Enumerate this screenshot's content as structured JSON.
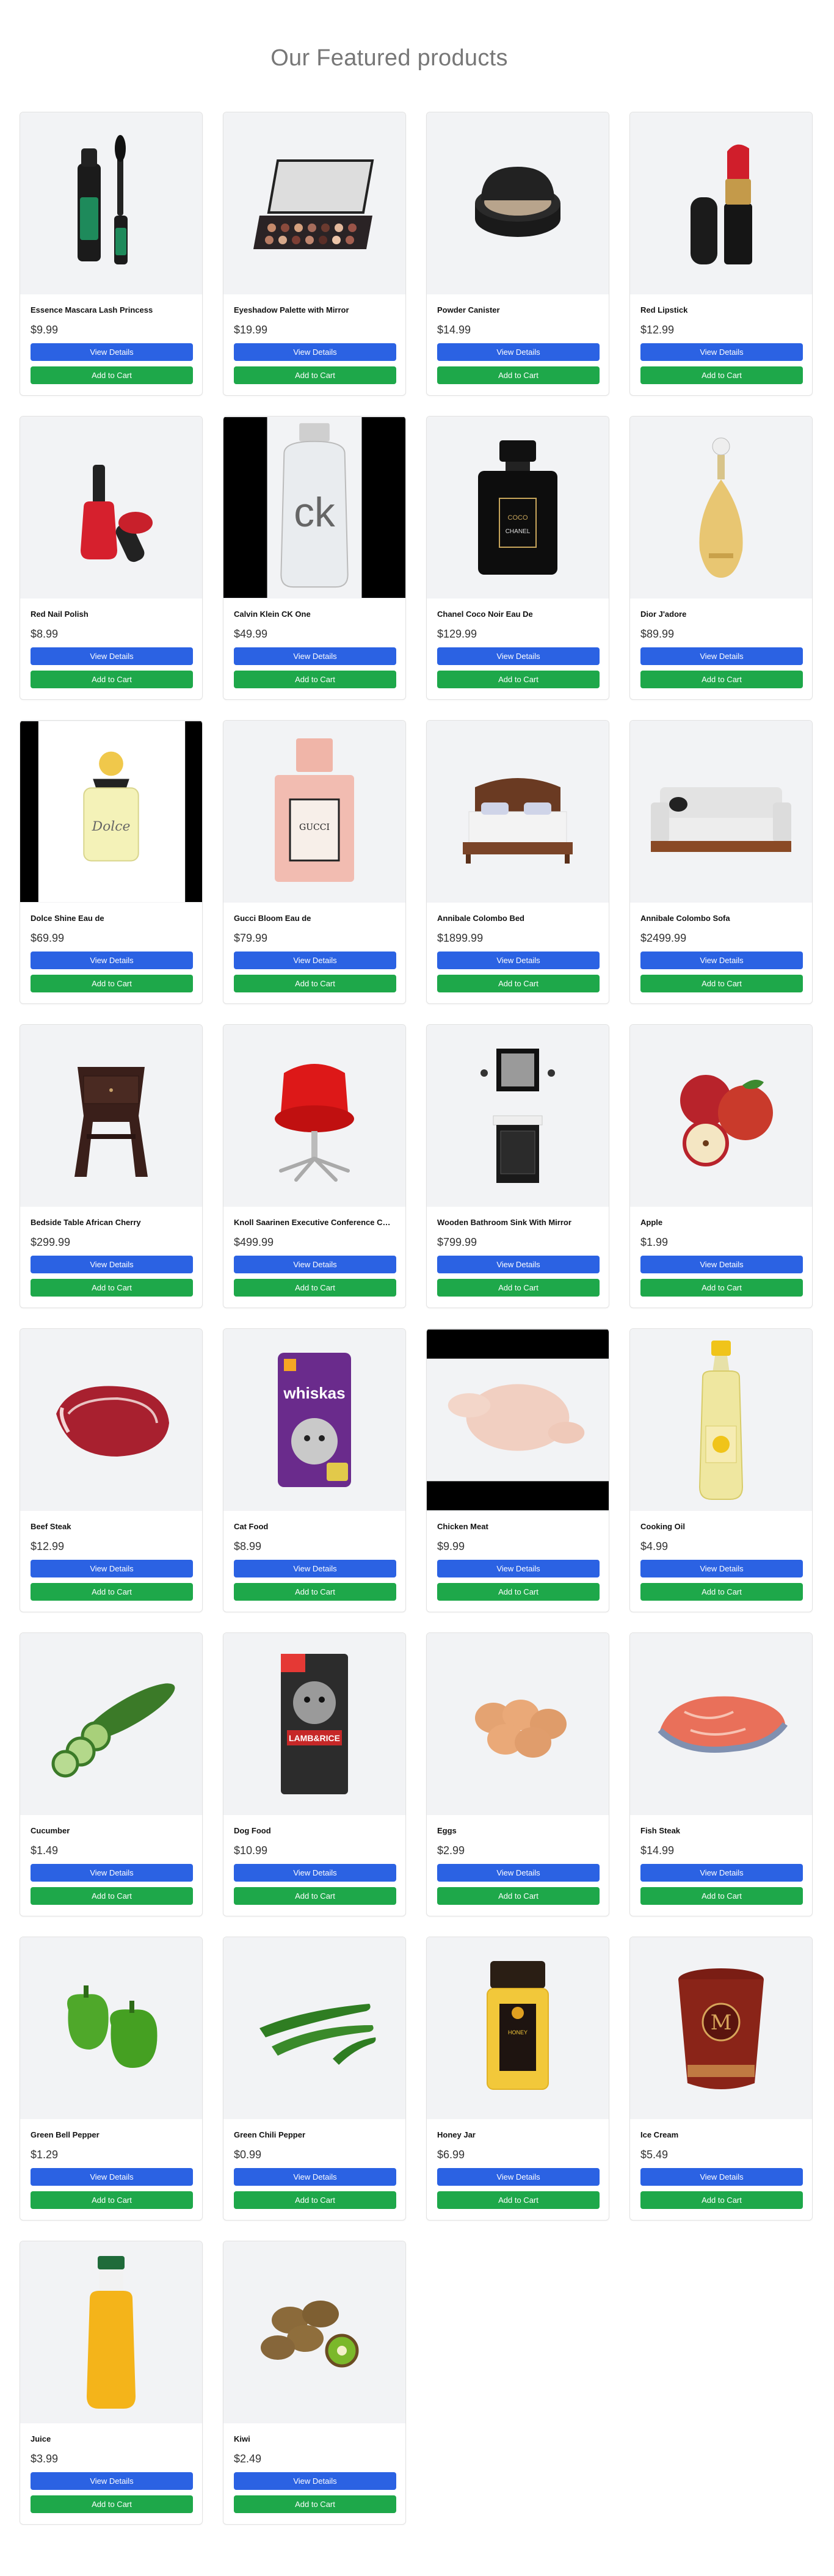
{
  "section": {
    "title": "Our Featured products"
  },
  "buttons": {
    "view_label": "View Details",
    "cart_label": "Add to Cart"
  },
  "colors": {
    "view_button": "#2b62e3",
    "cart_button": "#1ea84a",
    "image_bg": "#f2f3f5"
  },
  "products": [
    {
      "name": "Essence Mascara Lash Princess",
      "price": "$9.99",
      "icon": "mascara-icon"
    },
    {
      "name": "Eyeshadow Palette with Mirror",
      "price": "$19.99",
      "icon": "palette-icon"
    },
    {
      "name": "Powder Canister",
      "price": "$14.99",
      "icon": "powder-icon"
    },
    {
      "name": "Red Lipstick",
      "price": "$12.99",
      "icon": "lipstick-icon"
    },
    {
      "name": "Red Nail Polish",
      "price": "$8.99",
      "icon": "nail-polish-icon"
    },
    {
      "name": "Calvin Klein CK One",
      "price": "$49.99",
      "icon": "perfume-ck-icon"
    },
    {
      "name": "Chanel Coco Noir Eau De",
      "price": "$129.99",
      "icon": "perfume-chanel-icon"
    },
    {
      "name": "Dior J'adore",
      "price": "$89.99",
      "icon": "perfume-dior-icon"
    },
    {
      "name": "Dolce Shine Eau de",
      "price": "$69.99",
      "icon": "perfume-dolce-icon"
    },
    {
      "name": "Gucci Bloom Eau de",
      "price": "$79.99",
      "icon": "perfume-gucci-icon"
    },
    {
      "name": "Annibale Colombo Bed",
      "price": "$1899.99",
      "icon": "bed-icon"
    },
    {
      "name": "Annibale Colombo Sofa",
      "price": "$2499.99",
      "icon": "sofa-icon"
    },
    {
      "name": "Bedside Table African Cherry",
      "price": "$299.99",
      "icon": "bedside-table-icon"
    },
    {
      "name": "Knoll Saarinen Executive Conference Chair",
      "price": "$499.99",
      "icon": "chair-icon"
    },
    {
      "name": "Wooden Bathroom Sink With Mirror",
      "price": "$799.99",
      "icon": "sink-icon"
    },
    {
      "name": "Apple",
      "price": "$1.99",
      "icon": "apple-icon"
    },
    {
      "name": "Beef Steak",
      "price": "$12.99",
      "icon": "steak-icon"
    },
    {
      "name": "Cat Food",
      "price": "$8.99",
      "icon": "cat-food-icon"
    },
    {
      "name": "Chicken Meat",
      "price": "$9.99",
      "icon": "chicken-icon"
    },
    {
      "name": "Cooking Oil",
      "price": "$4.99",
      "icon": "oil-icon"
    },
    {
      "name": "Cucumber",
      "price": "$1.49",
      "icon": "cucumber-icon"
    },
    {
      "name": "Dog Food",
      "price": "$10.99",
      "icon": "dog-food-icon"
    },
    {
      "name": "Eggs",
      "price": "$2.99",
      "icon": "eggs-icon"
    },
    {
      "name": "Fish Steak",
      "price": "$14.99",
      "icon": "fish-icon"
    },
    {
      "name": "Green Bell Pepper",
      "price": "$1.29",
      "icon": "bell-pepper-icon"
    },
    {
      "name": "Green Chili Pepper",
      "price": "$0.99",
      "icon": "chili-icon"
    },
    {
      "name": "Honey Jar",
      "price": "$6.99",
      "icon": "honey-icon"
    },
    {
      "name": "Ice Cream",
      "price": "$5.49",
      "icon": "ice-cream-icon"
    },
    {
      "name": "Juice",
      "price": "$3.99",
      "icon": "juice-icon"
    },
    {
      "name": "Kiwi",
      "price": "$2.49",
      "icon": "kiwi-icon"
    }
  ]
}
